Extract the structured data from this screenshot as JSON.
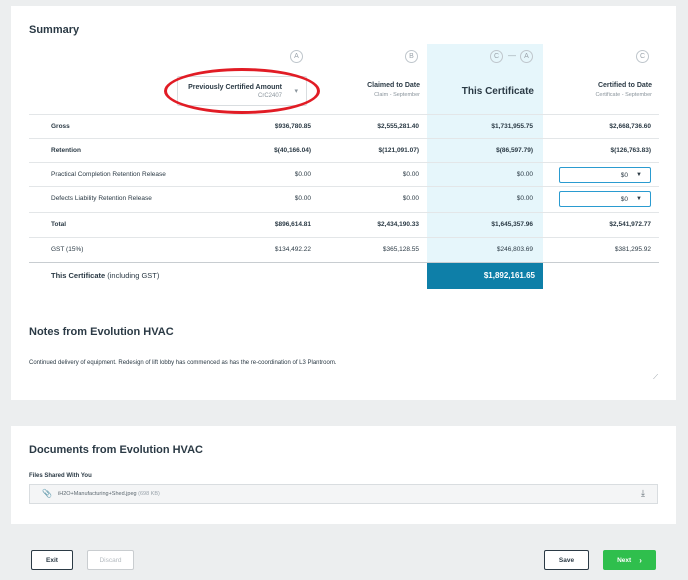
{
  "summary": {
    "title": "Summary",
    "badges": {
      "a": "A",
      "b": "B",
      "c_minus_a": [
        "C",
        "A"
      ],
      "c": "C"
    },
    "badge_dash": "—",
    "previous_dropdown": {
      "label": "Previously Certified Amount",
      "sub": "CrC2407"
    },
    "columns": {
      "claimed": {
        "title": "Claimed to Date",
        "sub": "Claim - September"
      },
      "this_certificate": {
        "title": "This Certificate"
      },
      "certified": {
        "title": "Certified to Date",
        "sub": "Certificate - September"
      }
    },
    "rows": [
      {
        "label": "Gross",
        "prev": "$936,780.85",
        "claimed": "$2,555,281.40",
        "this": "$1,731,955.75",
        "certified": "$2,668,736.60"
      },
      {
        "label": "Retention",
        "prev": "$(40,166.04)",
        "claimed": "$(121,091.07)",
        "this": "$(86,597.79)",
        "certified": "$(126,763.83)"
      },
      {
        "label": "Practical Completion Retention Release",
        "prev": "$0.00",
        "claimed": "$0.00",
        "this": "$0.00",
        "certified": "$0"
      },
      {
        "label": "Defects Liability Retention Release",
        "prev": "$0.00",
        "claimed": "$0.00",
        "this": "$0.00",
        "certified": "$0"
      },
      {
        "label": "Total",
        "prev": "$896,614.81",
        "claimed": "$2,434,190.33",
        "this": "$1,645,357.96",
        "certified": "$2,541,972.77"
      },
      {
        "label": "GST (15%)",
        "prev": "$134,492.22",
        "claimed": "$365,128.55",
        "this": "$246,803.69",
        "certified": "$381,295.92"
      }
    ],
    "total": {
      "label_bold": "This Certificate",
      "label_rest": " (including GST)",
      "value": "$1,892,161.65"
    }
  },
  "notes": {
    "title": "Notes from Evolution HVAC",
    "text": "Continued delivery of equipment. Redesign of lift lobby has commenced as has the re-coordination of L3 Plantroom."
  },
  "documents": {
    "title": "Documents from Evolution HVAC",
    "files_label": "Files Shared With You",
    "file": {
      "name": "iH2O+Manufacturing+Shed.jpeg",
      "size": "(698 KB)"
    }
  },
  "footer": {
    "exit": "Exit",
    "discard": "Discard",
    "save": "Save",
    "next": "Next"
  },
  "colors": {
    "accent": "#0e7fa8",
    "highlight": "#e6f6fb",
    "next": "#2fbf4d",
    "annotation": "#e11c25"
  }
}
